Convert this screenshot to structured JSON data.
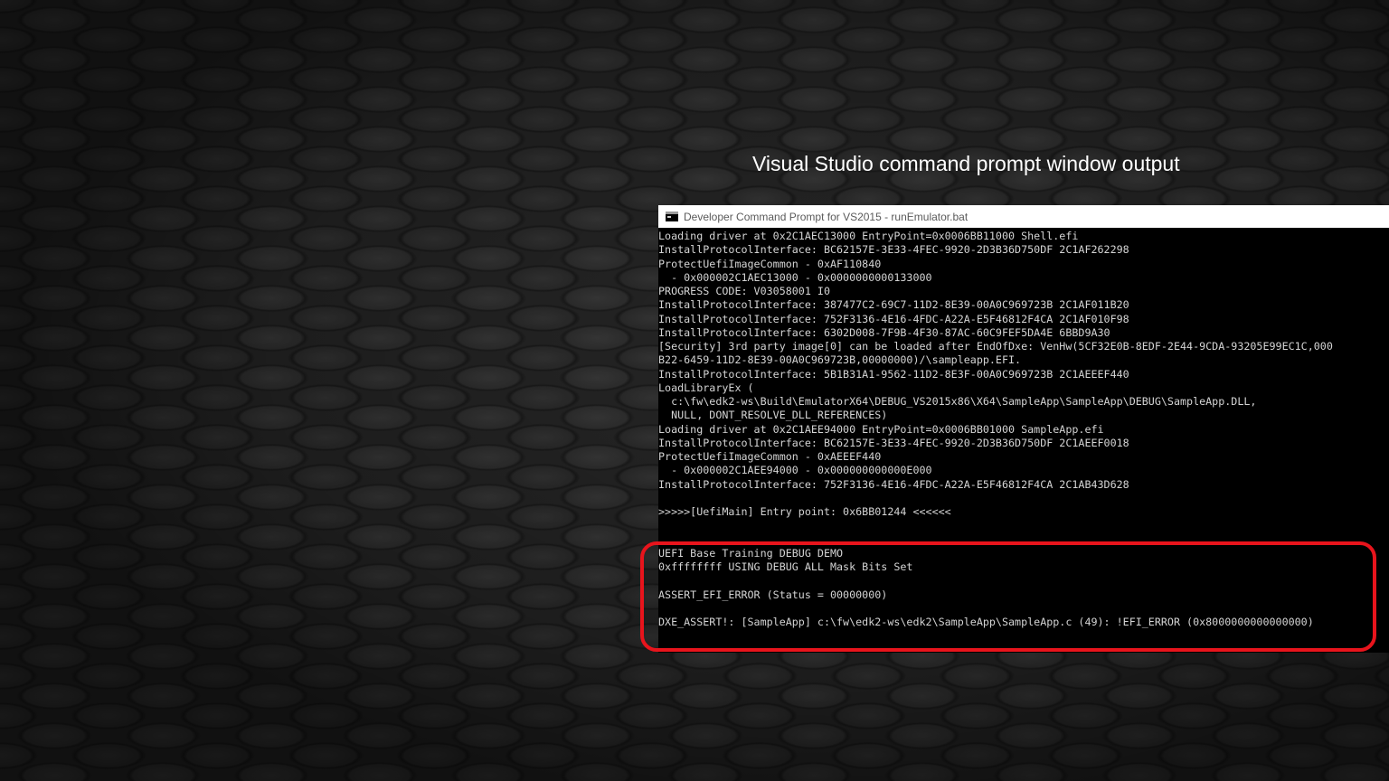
{
  "slide": {
    "title": "Visual Studio command prompt window output"
  },
  "window": {
    "title": "Developer Command Prompt for VS2015 - runEmulator.bat",
    "icon": "cmd-icon"
  },
  "console": {
    "lines": [
      "Loading driver at 0x2C1AEC13000 EntryPoint=0x0006BB11000 Shell.efi",
      "InstallProtocolInterface: BC62157E-3E33-4FEC-9920-2D3B36D750DF 2C1AF262298",
      "ProtectUefiImageCommon - 0xAF110840",
      "  - 0x000002C1AEC13000 - 0x0000000000133000",
      "PROGRESS CODE: V03058001 I0",
      "InstallProtocolInterface: 387477C2-69C7-11D2-8E39-00A0C969723B 2C1AF011B20",
      "InstallProtocolInterface: 752F3136-4E16-4FDC-A22A-E5F46812F4CA 2C1AF010F98",
      "InstallProtocolInterface: 6302D008-7F9B-4F30-87AC-60C9FEF5DA4E 6BBD9A30",
      "[Security] 3rd party image[0] can be loaded after EndOfDxe: VenHw(5CF32E0B-8EDF-2E44-9CDA-93205E99EC1C,000",
      "B22-6459-11D2-8E39-00A0C969723B,00000000)/\\sampleapp.EFI.",
      "InstallProtocolInterface: 5B1B31A1-9562-11D2-8E3F-00A0C969723B 2C1AEEEF440",
      "LoadLibraryEx (",
      "  c:\\fw\\edk2-ws\\Build\\EmulatorX64\\DEBUG_VS2015x86\\X64\\SampleApp\\SampleApp\\DEBUG\\SampleApp.DLL,",
      "  NULL, DONT_RESOLVE_DLL_REFERENCES)",
      "Loading driver at 0x2C1AEE94000 EntryPoint=0x0006BB01000 SampleApp.efi",
      "InstallProtocolInterface: BC62157E-3E33-4FEC-9920-2D3B36D750DF 2C1AEEF0018",
      "ProtectUefiImageCommon - 0xAEEEF440",
      "  - 0x000002C1AEE94000 - 0x000000000000E000",
      "InstallProtocolInterface: 752F3136-4E16-4FDC-A22A-E5F46812F4CA 2C1AB43D628",
      "",
      ">>>>>[UefiMain] Entry point: 0x6BB01244 <<<<<<",
      "",
      "",
      "UEFI Base Training DEBUG DEMO",
      "0xffffffff USING DEBUG ALL Mask Bits Set",
      "",
      "ASSERT_EFI_ERROR (Status = 00000000)",
      "",
      "DXE_ASSERT!: [SampleApp] c:\\fw\\edk2-ws\\edk2\\SampleApp\\SampleApp.c (49): !EFI_ERROR (0x8000000000000000)"
    ]
  },
  "colors": {
    "highlight": "#e8141c",
    "console_bg": "#000000",
    "console_text": "#d4d4d4"
  }
}
